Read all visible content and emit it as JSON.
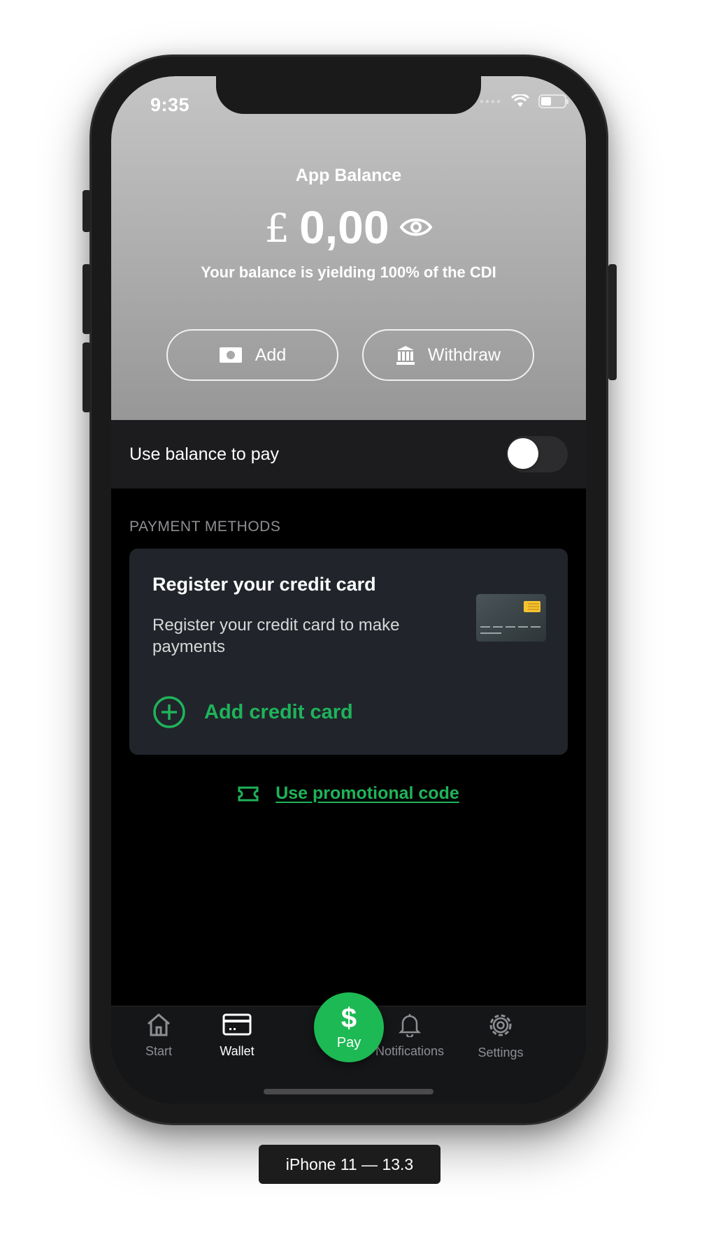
{
  "status_bar": {
    "time": "9:35"
  },
  "header": {
    "title": "App Balance",
    "currency_symbol": "£",
    "amount": "0,00",
    "yield_text": "Your balance is yielding 100% of the CDI",
    "add_label": "Add",
    "withdraw_label": "Withdraw"
  },
  "balance_toggle": {
    "label": "Use balance to pay",
    "enabled": false
  },
  "payment_methods": {
    "section_label": "PAYMENT METHODS",
    "card_title": "Register your credit card",
    "card_description": "Register your credit card to make payments",
    "add_card_label": "Add credit card"
  },
  "promo": {
    "label": "Use promotional code"
  },
  "tabbar": {
    "start": "Start",
    "wallet": "Wallet",
    "pay": "Pay",
    "pay_symbol": "$",
    "notifications": "Notifications",
    "settings": "Settings",
    "active_tab": "Wallet"
  },
  "device_label": "iPhone 11 — 13.3",
  "colors": {
    "accent_green": "#1fb35a",
    "pay_button": "#1db954",
    "card_background": "#21252b",
    "screen_background": "#000000"
  }
}
